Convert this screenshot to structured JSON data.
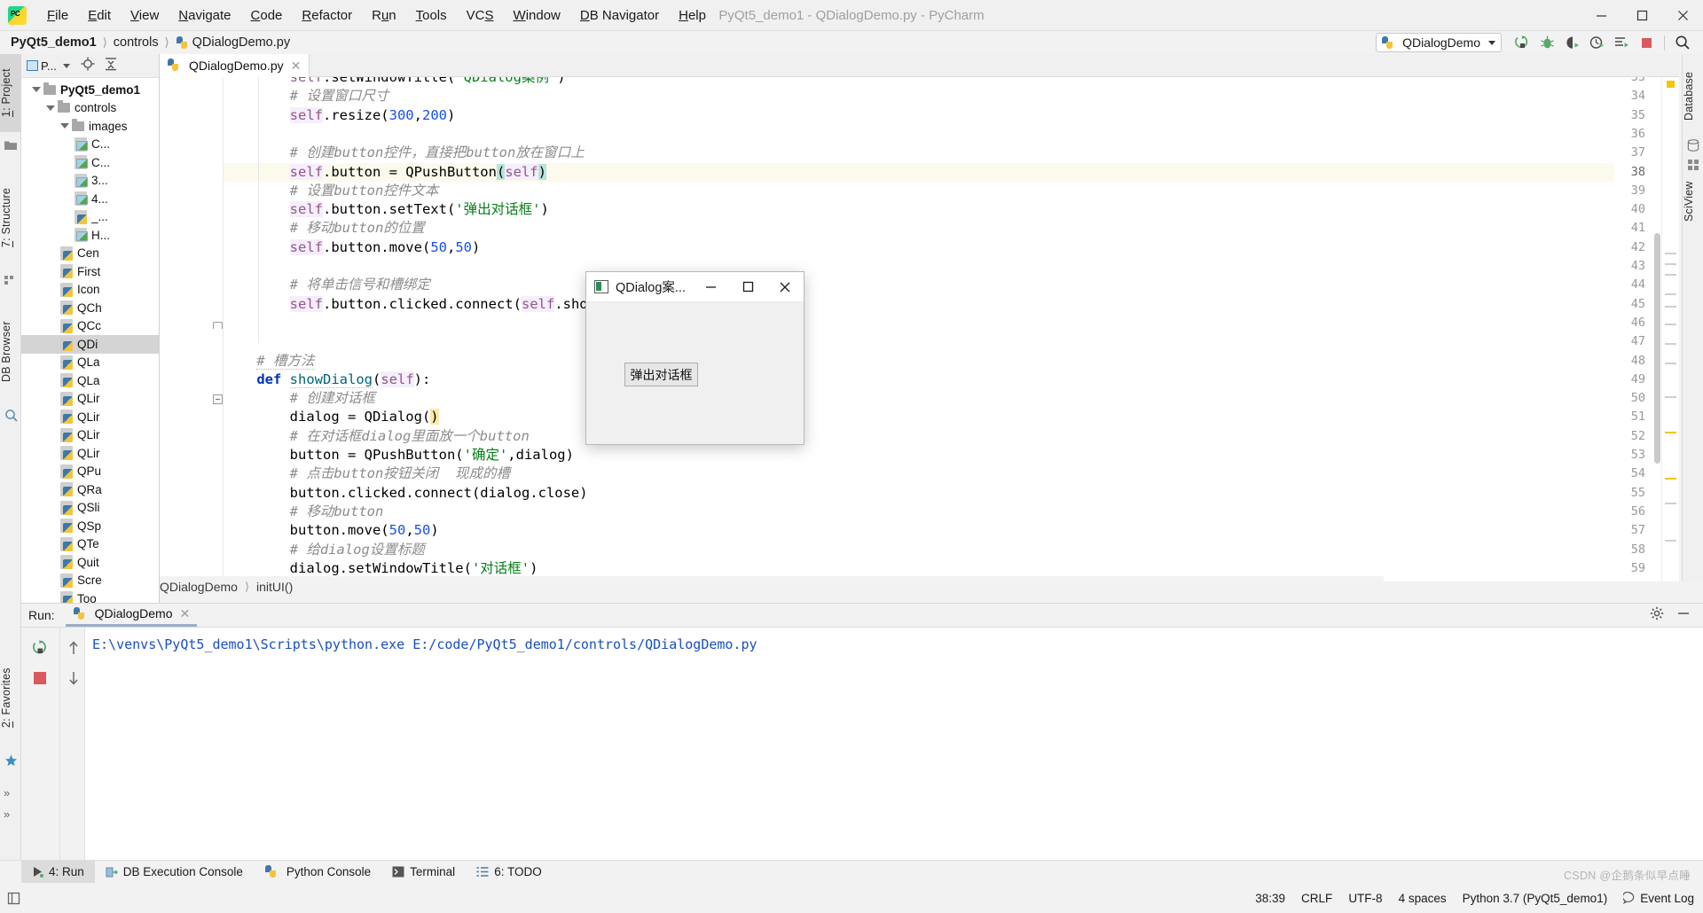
{
  "window": {
    "title": "PyQt5_demo1 - QDialogDemo.py - PyCharm",
    "minimize": "minimize-icon",
    "maximize": "maximize-icon",
    "close": "close-icon"
  },
  "menubar": {
    "items": [
      {
        "label": "File",
        "mnemonic": "F"
      },
      {
        "label": "Edit",
        "mnemonic": "E"
      },
      {
        "label": "View",
        "mnemonic": "V"
      },
      {
        "label": "Navigate",
        "mnemonic": "N"
      },
      {
        "label": "Code",
        "mnemonic": "C"
      },
      {
        "label": "Refactor",
        "mnemonic": "R"
      },
      {
        "label": "Run",
        "mnemonic": "u"
      },
      {
        "label": "Tools",
        "mnemonic": "T"
      },
      {
        "label": "VCS",
        "mnemonic": "S"
      },
      {
        "label": "Window",
        "mnemonic": "W"
      },
      {
        "label": "DB Navigator",
        "mnemonic": "D"
      },
      {
        "label": "Help",
        "mnemonic": "H"
      }
    ]
  },
  "breadcrumbs": {
    "project": "PyQt5_demo1",
    "folder": "controls",
    "file": "QDialogDemo.py"
  },
  "toolbar": {
    "run_config": "QDialogDemo",
    "buttons": [
      "run-icon",
      "debug-icon",
      "coverage-icon",
      "profile-icon",
      "run-with-console-icon",
      "stop-icon",
      "search-everywhere-icon"
    ]
  },
  "left_strip": {
    "tabs": [
      {
        "label": "1: Project",
        "mnemonic": "1",
        "selected": true
      },
      {
        "label": "7: Structure",
        "mnemonic": "7",
        "selected": false
      },
      {
        "label": "DB Browser",
        "mnemonic": "",
        "selected": false
      }
    ],
    "bottom_tabs": [
      {
        "label": "2: Favorites",
        "mnemonic": "2"
      }
    ]
  },
  "project_panel": {
    "selector_label": "P...",
    "header_icons": [
      "locate-icon",
      "collapse-all-icon"
    ],
    "tree": [
      {
        "label": "PyQt5_demo1",
        "type": "folder",
        "depth": 0,
        "expanded": true,
        "bold": true,
        "selected": false
      },
      {
        "label": "controls",
        "type": "folder",
        "depth": 1,
        "expanded": true,
        "bold": false,
        "selected": false
      },
      {
        "label": "images",
        "type": "folder",
        "depth": 2,
        "expanded": true,
        "bold": false,
        "selected": false
      },
      {
        "label": "C...",
        "type": "image",
        "depth": 3,
        "expanded": false,
        "bold": false,
        "selected": false
      },
      {
        "label": "C...",
        "type": "image",
        "depth": 3,
        "expanded": false,
        "bold": false,
        "selected": false
      },
      {
        "label": "3...",
        "type": "image",
        "depth": 3,
        "expanded": false,
        "bold": false,
        "selected": false
      },
      {
        "label": "4...",
        "type": "image",
        "depth": 3,
        "expanded": false,
        "bold": false,
        "selected": false
      },
      {
        "label": "_...",
        "type": "py",
        "depth": 3,
        "expanded": false,
        "bold": false,
        "selected": false
      },
      {
        "label": "H...",
        "type": "image",
        "depth": 3,
        "expanded": false,
        "bold": false,
        "selected": false
      },
      {
        "label": "Cen",
        "type": "py",
        "depth": 2,
        "expanded": false,
        "bold": false,
        "selected": false
      },
      {
        "label": "First",
        "type": "py",
        "depth": 2,
        "expanded": false,
        "bold": false,
        "selected": false
      },
      {
        "label": "Icon",
        "type": "py",
        "depth": 2,
        "expanded": false,
        "bold": false,
        "selected": false
      },
      {
        "label": "QCh",
        "type": "py",
        "depth": 2,
        "expanded": false,
        "bold": false,
        "selected": false
      },
      {
        "label": "QCc",
        "type": "py",
        "depth": 2,
        "expanded": false,
        "bold": false,
        "selected": false
      },
      {
        "label": "QDi",
        "type": "py",
        "depth": 2,
        "expanded": false,
        "bold": false,
        "selected": true
      },
      {
        "label": "QLa",
        "type": "py",
        "depth": 2,
        "expanded": false,
        "bold": false,
        "selected": false
      },
      {
        "label": "QLa",
        "type": "py",
        "depth": 2,
        "expanded": false,
        "bold": false,
        "selected": false
      },
      {
        "label": "QLir",
        "type": "py",
        "depth": 2,
        "expanded": false,
        "bold": false,
        "selected": false
      },
      {
        "label": "QLir",
        "type": "py",
        "depth": 2,
        "expanded": false,
        "bold": false,
        "selected": false
      },
      {
        "label": "QLir",
        "type": "py",
        "depth": 2,
        "expanded": false,
        "bold": false,
        "selected": false
      },
      {
        "label": "QLir",
        "type": "py",
        "depth": 2,
        "expanded": false,
        "bold": false,
        "selected": false
      },
      {
        "label": "QPu",
        "type": "py",
        "depth": 2,
        "expanded": false,
        "bold": false,
        "selected": false
      },
      {
        "label": "QRa",
        "type": "py",
        "depth": 2,
        "expanded": false,
        "bold": false,
        "selected": false
      },
      {
        "label": "QSli",
        "type": "py",
        "depth": 2,
        "expanded": false,
        "bold": false,
        "selected": false
      },
      {
        "label": "QSp",
        "type": "py",
        "depth": 2,
        "expanded": false,
        "bold": false,
        "selected": false
      },
      {
        "label": "QTe",
        "type": "py",
        "depth": 2,
        "expanded": false,
        "bold": false,
        "selected": false
      },
      {
        "label": "Quit",
        "type": "py",
        "depth": 2,
        "expanded": false,
        "bold": false,
        "selected": false
      },
      {
        "label": "Scre",
        "type": "py",
        "depth": 2,
        "expanded": false,
        "bold": false,
        "selected": false
      },
      {
        "label": "Too",
        "type": "py",
        "depth": 2,
        "expanded": false,
        "bold": false,
        "selected": false
      }
    ]
  },
  "editor": {
    "tab_label": "QDialogDemo.py",
    "tab_close": "close-icon",
    "first_line_number": 33,
    "current_line": 38,
    "lines": [
      {
        "num": 33,
        "html": "        <span class='slf2'>self</span>.setWindowTitle(<span class='s'>'QDialog案例'</span>)",
        "clipped": true
      },
      {
        "num": 34,
        "html": "        <span class='cm'># 设置窗口尺寸</span>"
      },
      {
        "num": 35,
        "html": "        <span class='slf'>self</span>.resize(<span class='n'>300</span>,<span class='n'>200</span>)"
      },
      {
        "num": 36,
        "html": ""
      },
      {
        "num": 37,
        "html": "        <span class='cm'># 创建button控件，直接把button放在窗口上</span>"
      },
      {
        "num": 38,
        "html": "        <span class='slf'>self</span>.button = QPushButton<span class='mt'>(</span><span class='slf'>self</span><span class='mt'>)</span>",
        "highlight": true
      },
      {
        "num": 39,
        "html": "        <span class='cm'># 设置button控件文本</span>"
      },
      {
        "num": 40,
        "html": "        <span class='slf'>self</span>.button.setText(<span class='s'>'弹出对话框'</span>)"
      },
      {
        "num": 41,
        "html": "        <span class='cm'># 移动button的位置</span>"
      },
      {
        "num": 42,
        "html": "        <span class='slf'>self</span>.button.move(<span class='n'>50</span>,<span class='n'>50</span>)"
      },
      {
        "num": 43,
        "html": ""
      },
      {
        "num": 44,
        "html": "        <span class='cm'># 将单击信号和槽绑定</span>"
      },
      {
        "num": 45,
        "html": "        <span class='slf'>self</span>.button.clicked.connect(<span class='slf'>self</span>.showDialog)"
      },
      {
        "num": 46,
        "html": ""
      },
      {
        "num": 47,
        "html": ""
      },
      {
        "num": 48,
        "html": "    <span class='cm undl'># 槽方法</span>"
      },
      {
        "num": 49,
        "html": "    <span class='k'>def</span> <span class='fn undl'>showDialog</span>(<span class='slf'>self</span>):"
      },
      {
        "num": 50,
        "html": "        <span class='cm'># 创建对话框</span>"
      },
      {
        "num": 51,
        "html": "        dialog = QDialog(<span class='ylw'>)</span>"
      },
      {
        "num": 52,
        "html": "        <span class='cm'># 在对话框dialog里面放一个button</span>"
      },
      {
        "num": 53,
        "html": "        button = QPushButton(<span class='s'>'确定'</span>,dialog)"
      },
      {
        "num": 54,
        "html": "        <span class='cm'># 点击button按钮关闭  现成的槽</span>"
      },
      {
        "num": 55,
        "html": "        button.clicked.connect(dialog.close)"
      },
      {
        "num": 56,
        "html": "        <span class='cm'># 移动button</span>"
      },
      {
        "num": 57,
        "html": "        button.move(<span class='n'>50</span>,<span class='n'>50</span>)"
      },
      {
        "num": 58,
        "html": "        <span class='cm'># 给dialog设置标题</span>"
      },
      {
        "num": 59,
        "html": "        dialog.setWindowTitle(<span class='s'>'对话框'</span>)"
      }
    ]
  },
  "editor_breadcrumb": {
    "class": "QDialogDemo",
    "method": "initUI()"
  },
  "qt_dialog": {
    "title": "QDialog案...",
    "icon": "app-window-icon",
    "minimize": "minimize-icon",
    "maximize": "maximize-icon",
    "close": "close-icon",
    "button_label": "弹出对话框"
  },
  "run_panel": {
    "label": "Run:",
    "tab_label": "QDialogDemo",
    "tab_close": "close-icon",
    "console_output": "E:\\venvs\\PyQt5_demo1\\Scripts\\python.exe E:/code/PyQt5_demo1/controls/QDialogDemo.py",
    "settings_icon": "gear-icon",
    "minimize_icon": "minimize-icon",
    "side_buttons": [
      "rerun-icon",
      "stop-icon",
      "scroll-up-icon",
      "scroll-down-icon"
    ]
  },
  "bottom_tabs": [
    {
      "label": "4: Run",
      "mnemonic": "4",
      "icon": "run-icon",
      "selected": true
    },
    {
      "label": "DB Execution Console",
      "mnemonic": "",
      "icon": "db-console-icon",
      "selected": false
    },
    {
      "label": "Python Console",
      "mnemonic": "",
      "icon": "python-icon",
      "selected": false
    },
    {
      "label": "Terminal",
      "mnemonic": "",
      "icon": "terminal-icon",
      "selected": false
    },
    {
      "label": "6: TODO",
      "mnemonic": "6",
      "icon": "todo-icon",
      "selected": false
    }
  ],
  "status_bar": {
    "caret_position": "38:39",
    "line_separator": "CRLF",
    "encoding": "UTF-8",
    "indent": "4 spaces",
    "interpreter": "Python 3.7 (PyQt5_demo1)",
    "event_log": "Event Log",
    "event_log_icon": "balloon-icon",
    "toggle_icon": "toggle-sidebar-icon"
  },
  "right_strip": {
    "tabs": [
      "Database",
      "SciView"
    ]
  },
  "watermark": "CSDN @企鹅条似早点睡",
  "colors": {
    "accent_green": "#59a869",
    "accent_red": "#db5860",
    "keyword_blue": "#0033b3",
    "string_green": "#067d17",
    "number_blue": "#1750eb",
    "comment_gray": "#8c8c8c",
    "self_purple": "#94558d",
    "current_line": "#fcfaec",
    "titlebar_bg": "#f0f0f0"
  }
}
